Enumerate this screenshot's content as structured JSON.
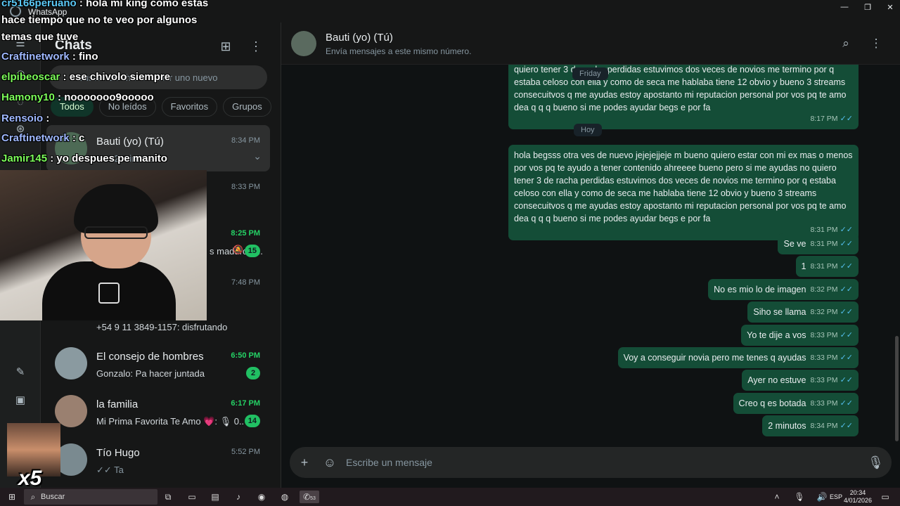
{
  "window": {
    "app_name": "WhatsApp",
    "minimize": "—",
    "maximize": "❐",
    "close": "✕"
  },
  "sidebar": {
    "title": "Chats",
    "search_placeholder": "Buscar un chat o iniciar uno nuevo",
    "filters": [
      "Todos",
      "No leídos",
      "Favoritos",
      "Grupos"
    ],
    "chats": [
      {
        "name": "Bauti (yo) (Tú)",
        "time": "8:34 PM",
        "preview": "✓✓ 2 minutos",
        "unread": false
      },
      {
        "name": "",
        "time": "8:33 PM",
        "preview": "",
        "unread": false
      },
      {
        "name": "",
        "time": "8:25 PM",
        "preview": "s maduro  0...",
        "unread": true,
        "badge": "15"
      },
      {
        "name": "",
        "time": "7:48 PM",
        "preview": "+54 9 11 3849-1157: disfrutando",
        "unread": false
      },
      {
        "name": "El consejo de hombres",
        "time": "6:50 PM",
        "preview": "Gonzalo: Pa hacer juntada",
        "unread": true,
        "badge": "2"
      },
      {
        "name": "la familia",
        "time": "6:17 PM",
        "preview": "Mi Prima Favorita Te Amo 💗: 🎙 0...",
        "unread": true,
        "badge": "14"
      },
      {
        "name": "Tío Hugo",
        "time": "5:52 PM",
        "preview": "✓✓ Ta",
        "unread": false
      }
    ]
  },
  "chat": {
    "name": "Bauti (yo) (Tú)",
    "subtitle": "Envía mensajes a este mismo número.",
    "day_friday": "Friday",
    "day_today": "Hoy",
    "composer_placeholder": "Escribe un mensaje",
    "messages": [
      {
        "text": "quiero tener 3 de racha perdidas estuvimos dos veces de novios me termino por q estaba celoso con ella y como de seca me hablaba tiene 12 obvio y bueno 3 streams consecuitvos q me ayudas estoy apostanto mi reputacion personal por vos pq te amo dea q q q bueno si me podes ayudar begs e por fa",
        "time": "8:17 PM"
      },
      {
        "text": "hola begsss otra ves de nuevo jejejejjeje m bueno quiero estar con mi ex mas o menos por vos pq te ayudo a tener contenido ahreeee bueno pero si me ayudas no quiero tener 3 de racha perdidas estuvimos dos veces de novios me termino por q estaba celoso con ella y como de seca me hablaba tiene 12 obvio y bueno 3 streams consecuitvos q me ayudas estoy apostanto mi reputacion personal por vos pq te amo dea q q q bueno si me podes ayudar begs e por fa",
        "time": "8:31 PM"
      },
      {
        "text": "Se ve",
        "time": "8:31 PM"
      },
      {
        "text": "1",
        "time": "8:31 PM"
      },
      {
        "text": "No es mio lo de imagen",
        "time": "8:32 PM"
      },
      {
        "text": "Siho se llama",
        "time": "8:32 PM"
      },
      {
        "text": "Yo te dije a vos",
        "time": "8:33 PM"
      },
      {
        "text": "Voy a conseguir novia pero me tenes q ayudas",
        "time": "8:33 PM"
      },
      {
        "text": "Ayer no estuve",
        "time": "8:33 PM"
      },
      {
        "text": "Creo q es botada",
        "time": "8:33 PM"
      },
      {
        "text": "2 minutos",
        "time": "8:34 PM"
      }
    ]
  },
  "stream_overlay": {
    "chat": [
      {
        "user": "cr5166peruano",
        "msg": " : hola mi king como estas"
      },
      {
        "user": "",
        "msg": "hace tiempo que no te veo por algunos"
      },
      {
        "user": "",
        "msg": "temas que tuve"
      },
      {
        "user": "Craftinetwork",
        "msg": " : fino"
      },
      {
        "user": "elpibeoscar",
        "msg": " : ese chivolo siempre"
      },
      {
        "user": "Hamony10",
        "msg": " : nooooooo9ooooo"
      },
      {
        "user": "Rensoio",
        "msg": " :"
      },
      {
        "user": "Craftinetwork",
        "msg": " : c"
      },
      {
        "user": "Jamir145",
        "msg": " : yo despues pe manito"
      }
    ],
    "multiplier": "x5"
  },
  "taskbar": {
    "search_label": "Buscar",
    "lang": "ESP",
    "time": "20:34",
    "date": "4/01/2026",
    "wa_badge": "53"
  },
  "colors": {
    "bubble": "#144d37",
    "accent": "#25d366",
    "ticks": "#53bdeb"
  }
}
